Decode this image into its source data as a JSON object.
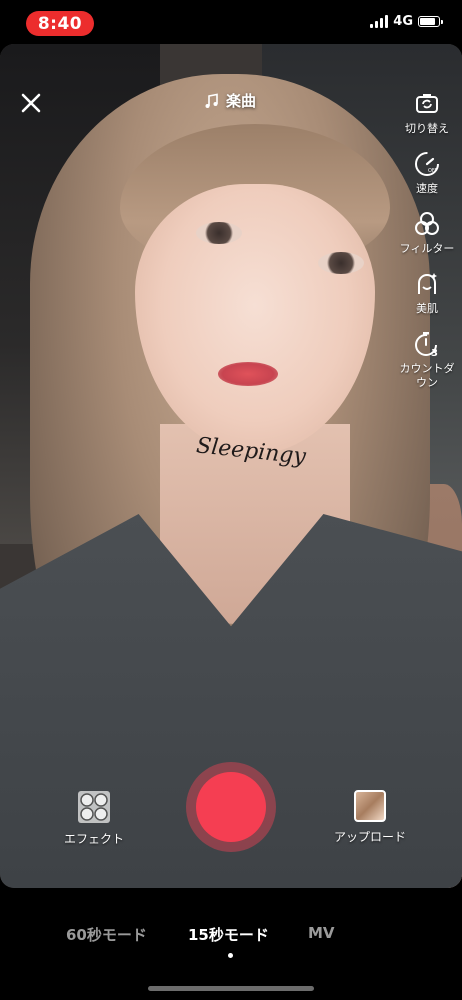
{
  "status_bar": {
    "time": "8:40",
    "network": "4G",
    "signal_bars": 4,
    "battery_level": 0.85,
    "accent_color": "#ec2d2d"
  },
  "viewport": {
    "watermark_text": "Sleepingy"
  },
  "top": {
    "close_icon": "close-icon",
    "music_label": "楽曲",
    "music_icon": "music-note-icon"
  },
  "tools": [
    {
      "icon": "flip-camera-icon",
      "label": "切り替え"
    },
    {
      "icon": "speed-icon",
      "label": "速度"
    },
    {
      "icon": "filter-icon",
      "label": "フィルター"
    },
    {
      "icon": "beauty-icon",
      "label": "美肌"
    },
    {
      "icon": "timer-icon",
      "label": "カウントダウン"
    }
  ],
  "bottom": {
    "effect_label": "エフェクト",
    "effect_icon": "effect-icon",
    "upload_label": "アップロード",
    "record_color": "#f53e52"
  },
  "modes": {
    "items": [
      "60秒モード",
      "15秒モード",
      "MV"
    ],
    "selected": "15秒モード"
  }
}
